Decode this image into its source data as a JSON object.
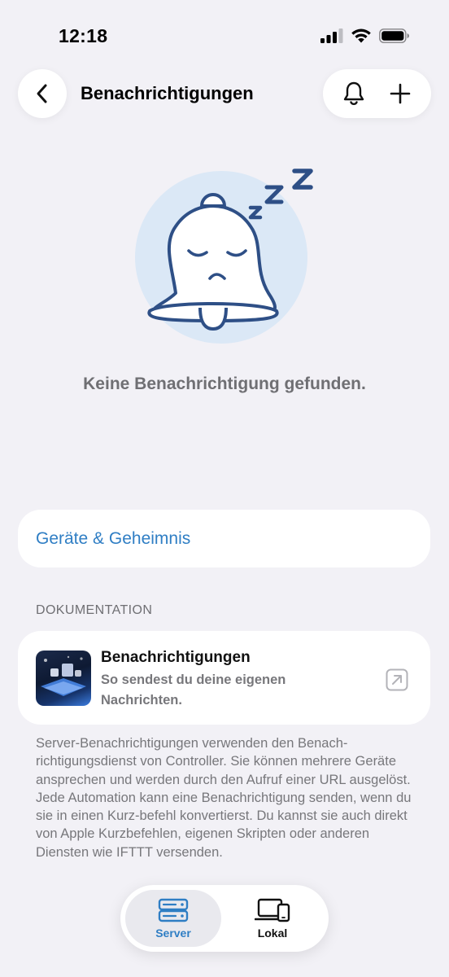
{
  "status": {
    "time": "12:18",
    "icons": [
      "signal-icon",
      "wifi-icon",
      "battery-icon"
    ]
  },
  "nav": {
    "title": "Benachrichtigungen",
    "back_icon": "chevron-left-icon",
    "actions": [
      "bell-icon",
      "plus-icon"
    ]
  },
  "empty_state": {
    "illustration": "sleeping-bell-icon",
    "message": "Keine Benachrichtigung gefunden."
  },
  "devices": {
    "link_label": "Geräte & Geheimnis"
  },
  "documentation": {
    "header": "DOKUMENTATION",
    "card": {
      "title": "Benachrichtigungen",
      "subtitle": "So sendest du deine eigenen Nachrichten.",
      "action_icon": "external-link-icon"
    },
    "body": "Server-Benachrichtigungen verwenden den Benach-richtigungsdienst von Controller. Sie können mehrere Geräte ansprechen und werden durch den Aufruf einer URL ausgelöst. Jede Automation kann eine Benachrichtigung senden, wenn du sie in einen Kurz-befehl konvertierst. Du kannst sie auch direkt von Apple Kurzbefehlen, eigenen Skripten oder anderen Diensten wie IFTTT versenden."
  },
  "tabbar": {
    "tabs": [
      {
        "label": "Server",
        "icon": "server-icon",
        "selected": true
      },
      {
        "label": "Lokal",
        "icon": "laptop-phone-icon",
        "selected": false
      }
    ]
  },
  "colors": {
    "accent": "#2f7ec4",
    "background": "#f2f1f6",
    "illustration_stroke": "#2e4f86",
    "illustration_circle": "#dbe8f6"
  }
}
